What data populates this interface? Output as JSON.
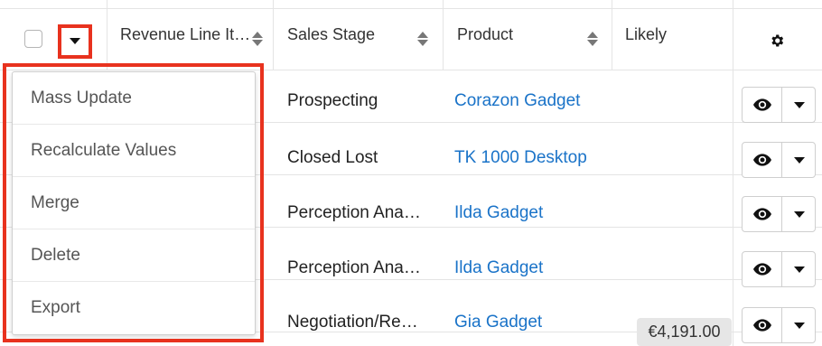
{
  "header": {
    "columns": [
      {
        "label": "Revenue Line It…"
      },
      {
        "label": "Sales Stage"
      },
      {
        "label": "Product"
      },
      {
        "label": "Likely"
      }
    ]
  },
  "actions_menu": {
    "items": [
      {
        "label": "Mass Update"
      },
      {
        "label": "Recalculate Values"
      },
      {
        "label": "Merge"
      },
      {
        "label": "Delete"
      },
      {
        "label": "Export"
      }
    ]
  },
  "rows": [
    {
      "name_truncated": ".",
      "sales_stage": "Prospecting",
      "product": "Corazon Gadget",
      "likely": ""
    },
    {
      "name_truncated": "",
      "sales_stage": "Closed Lost",
      "product": "TK 1000 Desktop",
      "likely": ""
    },
    {
      "name_truncated": "",
      "sales_stage": "Perception Ana…",
      "product": "Ilda Gadget",
      "likely": ""
    },
    {
      "name_truncated": "",
      "sales_stage": "Perception Ana…",
      "product": "Ilda Gadget",
      "likely": ""
    },
    {
      "name_truncated": "",
      "sales_stage": "Negotiation/Re…",
      "product": "Gia Gadget",
      "likely": "€4,191.00"
    }
  ],
  "icons": {
    "settings": "gear-icon",
    "preview": "eye-icon",
    "row_menu": "caret-down-icon",
    "sort": "sort-icon"
  },
  "colors": {
    "link": "#1a73c8",
    "highlight": "#e8321e",
    "badge_bg": "#e6e6e6"
  }
}
